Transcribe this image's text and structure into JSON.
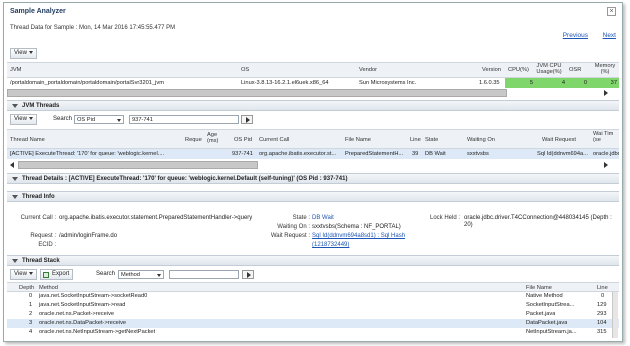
{
  "dialog": {
    "title": "Sample Analyzer",
    "subtitle": "Thread Data for Sample : Mon, 14 Mar 2016 17:45:55.477 PM",
    "previous": "Previous",
    "next": "Next",
    "close": "×"
  },
  "jvm_table": {
    "view_label": "View",
    "headers": {
      "jvm": "JVM",
      "os": "OS",
      "vendor": "Vendor",
      "version": "Version",
      "cpu": "CPU(%)",
      "jvm_cpu": "JVM CPU Usage(%)",
      "osr": "OSR",
      "memory": "Memory (%)"
    },
    "row": {
      "jvm": "/portaldomain_portaldomain/portaldomain/portalSvr3201_jvm",
      "os": "Linux-3.8.13-16.2.1.el6uek.x86_64",
      "vendor": "Sun Microsystems Inc.",
      "version": "1.6.0.35",
      "cpu": "5",
      "jvm_cpu": "4",
      "osr": "0",
      "memory": "37"
    }
  },
  "jvm_threads": {
    "section_title": "JVM Threads",
    "view_label": "View",
    "search_label": "Search",
    "search_field": "OS Pid",
    "search_value": "937-741",
    "headers": {
      "thread_name": "Thread Name",
      "request": "Reque",
      "age": "Age (ms)",
      "os_pid": "OS Pid",
      "current_call": "Current Call",
      "file_name": "File Name",
      "line": "Line",
      "state": "State",
      "waiting_on": "Waiting On",
      "wait_request": "Wait Request",
      "wait_time": "Wai Tim (se"
    },
    "row": {
      "thread_name": "[ACTIVE] ExecuteThread: '170' for queue: 'weblogic.kernel....",
      "request": "",
      "age": "",
      "os_pid": "937-741",
      "current_call": "org.apache.ibatis.executor.st...",
      "file_name": "PreparedStatementH...",
      "line": "39",
      "state": "DB Wait",
      "waiting_on": "sxxtvsbs",
      "wait_request": "Sql Id(ddnvm694a...",
      "wait_extra": "oracle.jdbc"
    }
  },
  "thread_details": {
    "title": "Thread Details : [ACTIVE] ExecuteThread: '170' for queue: 'weblogic.kernel.Default (self-tuning)' (OS Pid : 937-741)"
  },
  "thread_info": {
    "section_title": "Thread Info",
    "current_call_label": "Current Call :",
    "current_call": "org.apache.ibatis.executor.statement.PreparedStatementHandler->query",
    "request_label": "Request :",
    "request": "/admin/loginFrame.do",
    "ecid_label": "ECID :",
    "ecid": "",
    "state_label": "State :",
    "state": "DB Wait",
    "waiting_on_label": "Waiting On :",
    "waiting_on": "sxxtvsbs(Schema : NF_PORTAL)",
    "wait_request_label": "Wait Request :",
    "wait_request_1": "Sql Id(ddnvm694a8sd1) : Sql Hash",
    "wait_request_2": "(1218732449)",
    "lock_held_label": "Lock Held :",
    "lock_held": "oracle.jdbc.driver.T4CConnection@448034145 (Depth : 20)"
  },
  "thread_stack": {
    "section_title": "Thread Stack",
    "view_label": "View",
    "export_label": "Export",
    "search_label": "Search",
    "search_field": "Method",
    "search_value": "",
    "headers": {
      "depth": "Depth",
      "method": "Method",
      "file_name": "File Name",
      "line": "Line"
    },
    "rows": [
      {
        "depth": "0",
        "method": "java.net.SocketInputStream->socketRead0",
        "file": "Native Method",
        "line": "0"
      },
      {
        "depth": "1",
        "method": "java.net.SocketInputStream->read",
        "file": "SocketInputStrea...",
        "line": "129"
      },
      {
        "depth": "2",
        "method": "oracle.net.ns.Packet->receive",
        "file": "Packet.java",
        "line": "293"
      },
      {
        "depth": "3",
        "method": "oracle.net.ns.DataPacket->receive",
        "file": "DataPacket.java",
        "line": "104"
      },
      {
        "depth": "4",
        "method": "oracle.net.ns.NetInputStream->getNextPacket",
        "file": "NetInputStream.ja...",
        "line": "315"
      }
    ]
  }
}
